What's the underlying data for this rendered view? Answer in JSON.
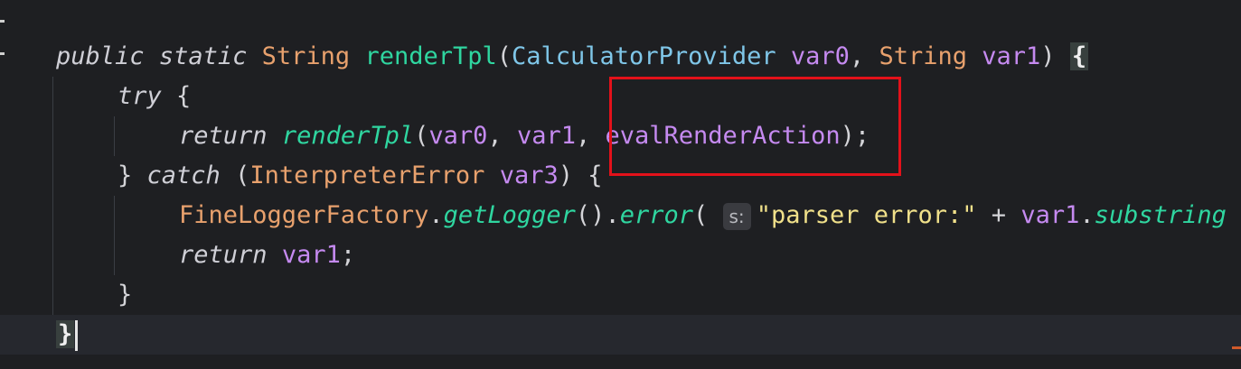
{
  "code": {
    "line1": {
      "kw_public": "public",
      "kw_static": "static",
      "type_string": "String",
      "fn_name": "renderTpl",
      "open_paren": "(",
      "param_type_1": "CalculatorProvider",
      "param_name_1": "var0",
      "comma": ",",
      "param_type_2": "String",
      "param_name_2": "var1",
      "close_paren": ")",
      "open_brace": "{"
    },
    "line2": {
      "kw_try": "try",
      "open_brace": "{"
    },
    "line3": {
      "kw_return": "return",
      "fn_call": "renderTpl",
      "open_paren": "(",
      "arg1": "var0",
      "sep1": ",",
      "arg2": "var1",
      "sep2": ",",
      "arg3": "evalRenderAction",
      "close": ");"
    },
    "line4": {
      "close_brace": "}",
      "kw_catch": "catch",
      "open_paren": "(",
      "exception_type": "InterpreterError",
      "exception_var": "var3",
      "close_paren": ")",
      "open_brace": "{"
    },
    "line5": {
      "class_name": "FineLoggerFactory",
      "dot1": ".",
      "method1": "getLogger",
      "parens1": "()",
      "dot2": ".",
      "method2": "error",
      "open_paren": "(",
      "param_hint": "s:",
      "string_literal": "\"parser error:\"",
      "plus": "+",
      "var": "var1",
      "dot3": ".",
      "method3": "substring"
    },
    "line6": {
      "kw_return": "return",
      "var": "var1",
      "semicolon": ";"
    },
    "line7": {
      "close_brace": "}"
    },
    "line8": {
      "close_brace": "}"
    }
  },
  "colors": {
    "background": "#1e1f22",
    "highlight_box": "#e3111a",
    "keyword": "#cfcfd6",
    "type": "#e8a16d",
    "function": "#2fd6a0",
    "variable": "#c58af0",
    "string": "#f0e08a"
  }
}
